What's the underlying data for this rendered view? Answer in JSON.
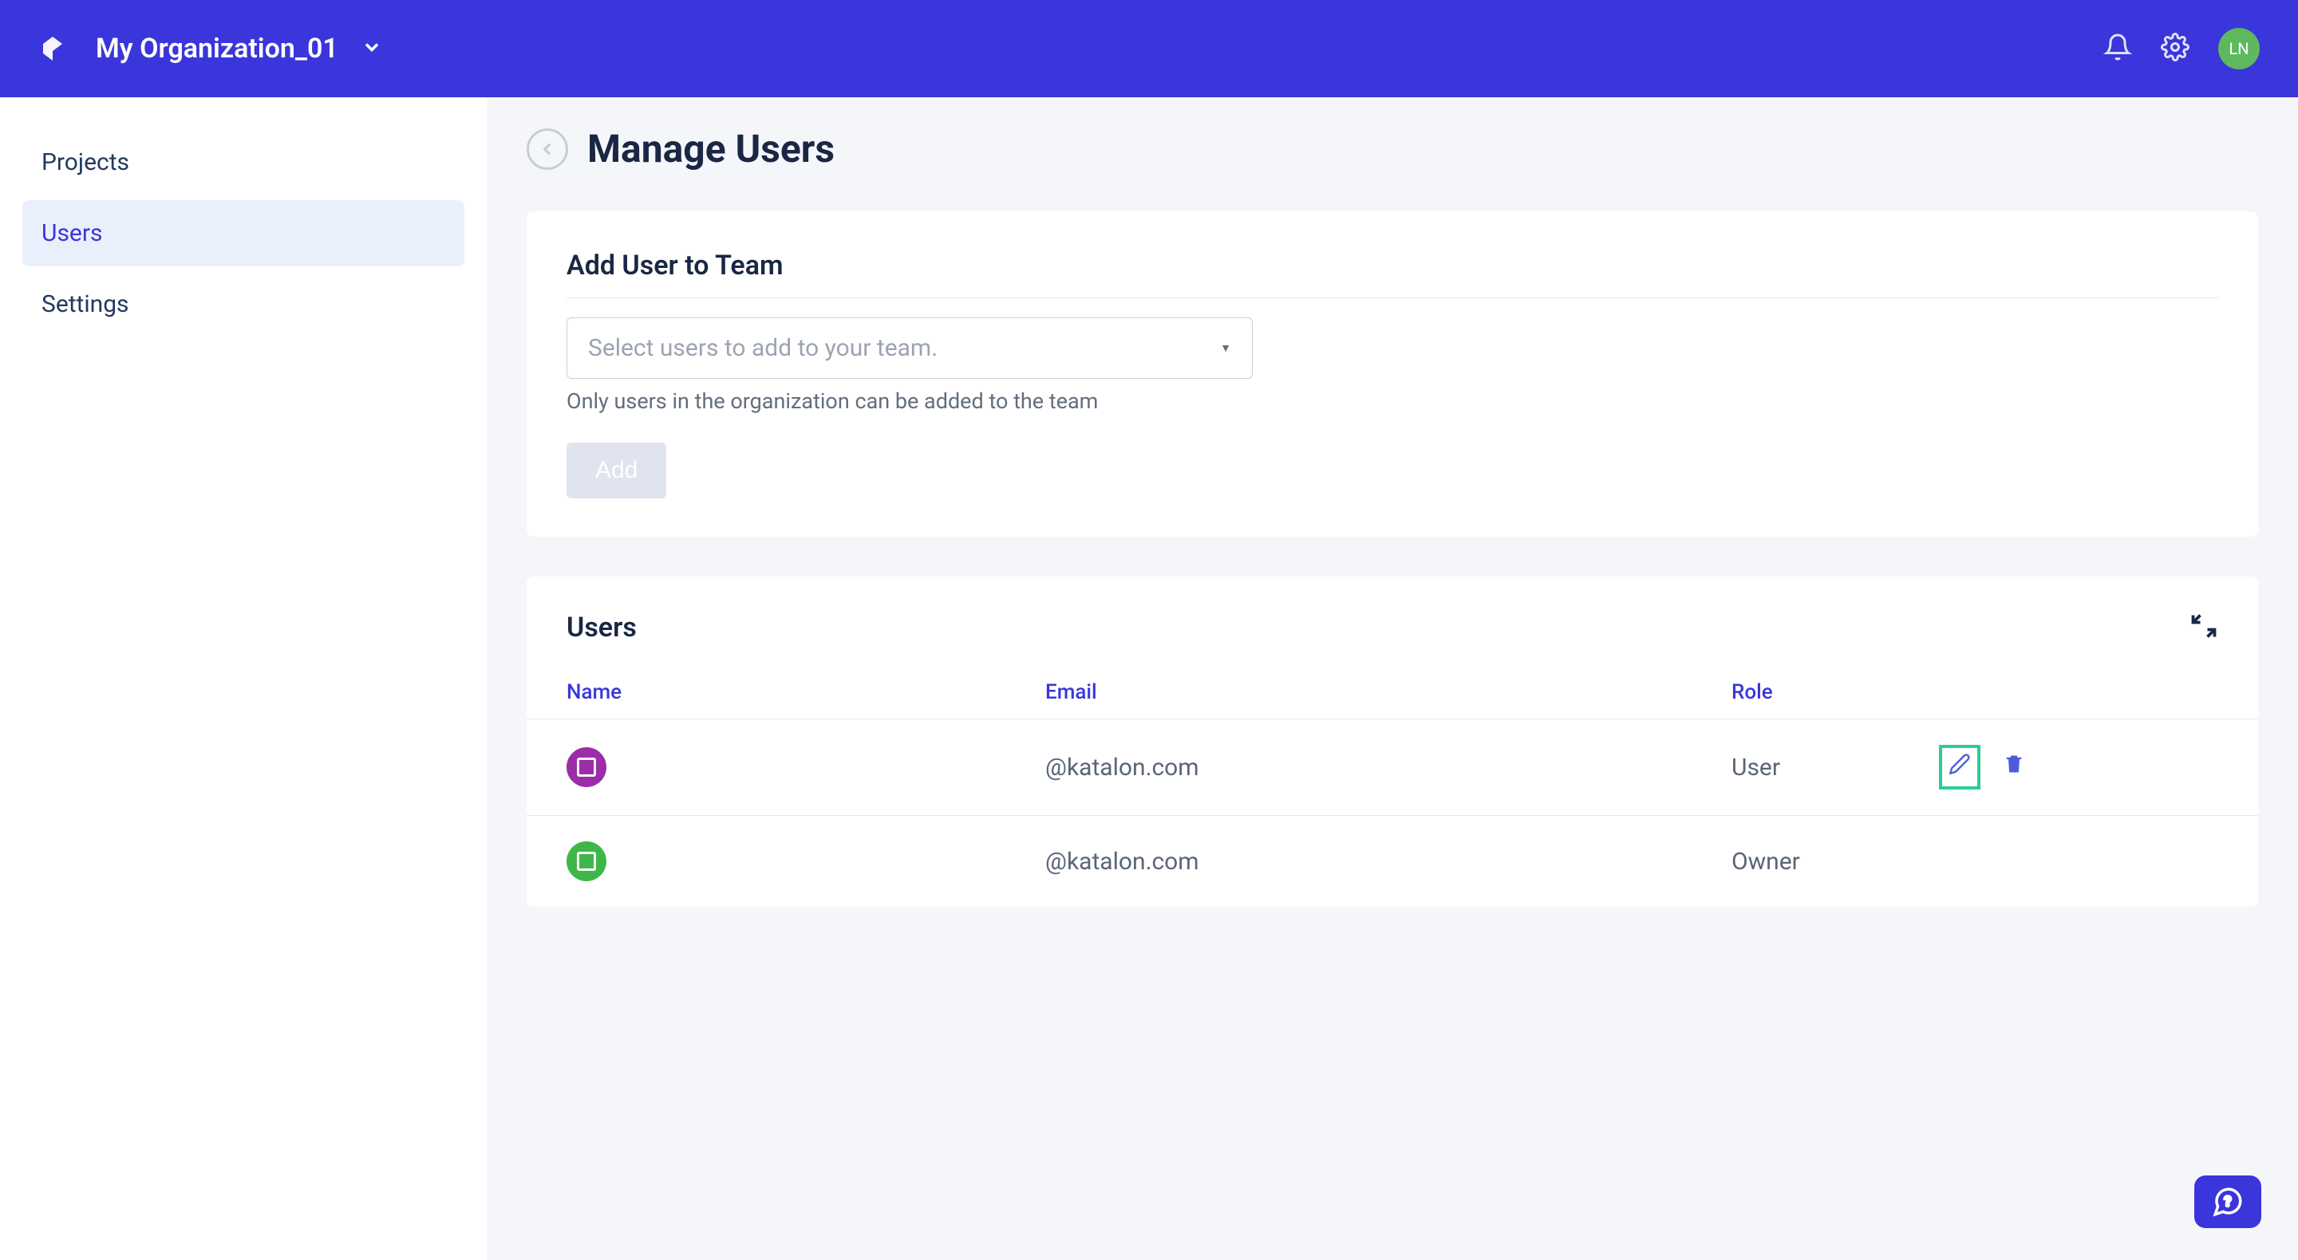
{
  "header": {
    "org_name": "My Organization_01",
    "avatar_initials": "LN"
  },
  "sidebar": {
    "items": [
      {
        "label": "Projects"
      },
      {
        "label": "Users"
      },
      {
        "label": "Settings"
      }
    ]
  },
  "page": {
    "title": "Manage Users"
  },
  "add_user_card": {
    "title": "Add User to Team",
    "select_placeholder": "Select users to add to your team.",
    "helper_text": "Only users in the organization can be added to the team",
    "add_button": "Add"
  },
  "users_section": {
    "title": "Users",
    "columns": {
      "name": "Name",
      "email": "Email",
      "role": "Role"
    },
    "rows": [
      {
        "name": "",
        "email": "@katalon.com",
        "role": "User",
        "avatar_color": "purple",
        "has_actions": true
      },
      {
        "name": "",
        "email": "@katalon.com",
        "role": "Owner",
        "avatar_color": "green",
        "has_actions": false
      }
    ]
  }
}
